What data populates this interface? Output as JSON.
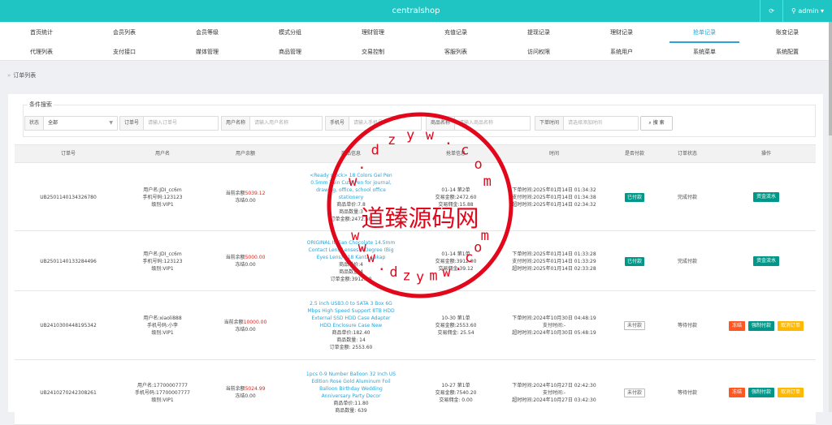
{
  "header": {
    "title": "centralshop",
    "refresh_icon": "refresh-icon",
    "user_icon": "user-icon",
    "user_label": "admin",
    "caret": "▾"
  },
  "nav": {
    "row1": [
      "首页统计",
      "会员列表",
      "会员等级",
      "模式分组",
      "理财管理",
      "充值记录",
      "提现记录",
      "理财记录",
      "抢单记录",
      "账变记录"
    ],
    "row2": [
      "代理列表",
      "支付接口",
      "媒体管理",
      "商品管理",
      "交易控制",
      "客服列表",
      "访问权限",
      "系统用户",
      "系统菜单",
      "系统配置"
    ],
    "active": "抢单记录"
  },
  "breadcrumb": {
    "separator": "»",
    "label": "订单列表"
  },
  "filter": {
    "legend": "条件搜索",
    "status_label": "状态",
    "status_value": "全部",
    "order_label": "订单号",
    "order_placeholder": "请输入订单号",
    "user_label": "用户名称",
    "user_placeholder": "请输入用户名称",
    "phone_label": "手机号",
    "phone_placeholder": "请输入手机号",
    "goods_label": "商品名称",
    "goods_placeholder": "请输入商品名称",
    "time_label": "下单时间",
    "time_placeholder": "请选择添加时间",
    "search_label": "搜 索",
    "search_icon": "search-icon"
  },
  "table": {
    "headers": [
      "订单号",
      "用户名",
      "用户余额",
      "商品信息",
      "抢单信息",
      "时间",
      "是否付款",
      "订单状态",
      "操作"
    ],
    "rows": [
      {
        "order_no": "UB2501140134326780",
        "user": [
          "用户名:JDI_cc6m",
          "手机号码:123123",
          "级别:VIP1"
        ],
        "balance_prefix": "当前余额",
        "balance": "5039.12",
        "frozen": "冻结0.00",
        "goods_title": "<Ready stock> 18 Colors Gel Pen 0.5mm Twin Cute Pen for journal, drawing, office, school office stationery",
        "goods_lines": [
          "商品单价:7.8",
          "商品数量:3",
          "订单金额:2472.60"
        ],
        "grab": [
          "01-14 第2单",
          "交易金额:2472.60",
          "交易佣金:15.88"
        ],
        "times": [
          "下单时间:2025年01月14日 01:34:32",
          "支付时间:2025年01月14日 01:34:38",
          "超时时间:2025年01月14日 02:34:32"
        ],
        "paid": "已付款",
        "paid_style": "green",
        "status": "完成付款",
        "ops": [
          {
            "label": "资金流水",
            "style": "green"
          }
        ]
      },
      {
        "order_no": "UB2501140133284496",
        "user": [
          "用户名:JDI_cc6m",
          "手机号码:123123",
          "级别:VIP1"
        ],
        "balance_prefix": "当前余额",
        "balance": "5000.00",
        "frozen": "冻结0.00",
        "goods_title": "ORIGINAL Italian Chocolate 14.5mm Contact Lens Lenses 0 Degree (Big Eyes Lens) 818 Kanta Lekap",
        "goods_lines": [
          "商品单价:4",
          "商品数量:4",
          "订单金额:3912.00"
        ],
        "grab": [
          "01-14 第1单",
          "交易金额:3912.00",
          "交易佣金:39.12"
        ],
        "times": [
          "下单时间:2025年01月14日 01:33:28",
          "支付时间:2025年01月14日 01:33:29",
          "超时时间:2025年01月14日 02:33:28"
        ],
        "paid": "已付款",
        "paid_style": "green",
        "status": "完成付款",
        "ops": [
          {
            "label": "资金流水",
            "style": "green"
          }
        ]
      },
      {
        "order_no": "UB2410300448195342",
        "user": [
          "用户名:xiaoli888",
          "手机号码:小李",
          "级别:VIP1"
        ],
        "balance_prefix": "当前余额",
        "balance": "10000.00",
        "frozen": "冻结0.00",
        "goods_title": "2.5 inch USB3.0 to SATA 3 Box 6G Mbps High Speed Support 8TB HDD External SSD HDD Case Adapter HDD Enclosure Case New",
        "goods_lines": [
          "商品单价:182.40",
          "商品数量: 14",
          "订单金额: 2553.60"
        ],
        "grab": [
          "10-30 第1单",
          "交易金额:2553.60",
          "交易佣金: 25.54"
        ],
        "times": [
          "下单时间:2024年10月30日 04:48:19",
          "支付时间:-",
          "超时时间:2024年10月30日 05:48:19"
        ],
        "paid": "未付款",
        "paid_style": "outline",
        "status": "等待付款",
        "ops": [
          {
            "label": "冻结",
            "style": "red"
          },
          {
            "label": "强制付款",
            "style": "green"
          },
          {
            "label": "取消订单",
            "style": "yellow"
          }
        ]
      },
      {
        "order_no": "UB2410270242308261",
        "user": [
          "用户名:17700007777",
          "手机号码:17700007777",
          "级别:VIP1"
        ],
        "balance_prefix": "当前余额",
        "balance": "5024.99",
        "frozen": "冻结0.00",
        "goods_title": "1pcs 0-9 Number Balloon 32 Inch US Edition Rose Gold Aluminum Foil Balloon Birthday Wedding Anniversary Party Decor",
        "goods_lines": [
          "商品单价:11.80",
          "商品数量: 639"
        ],
        "grab": [
          "10-27 第1单",
          "交易金额:7540.20",
          "交易佣金: 0.00"
        ],
        "times": [
          "下单时间:2024年10月27日 02:42:30",
          "支付时间:-",
          "超时时间:2024年10月27日 03:42:30"
        ],
        "paid": "未付款",
        "paid_style": "outline",
        "status": "等待付款",
        "ops": [
          {
            "label": "冻结",
            "style": "red"
          },
          {
            "label": "强制付款",
            "style": "green"
          },
          {
            "label": "取消订单",
            "style": "yellow"
          }
        ]
      }
    ]
  },
  "watermark": {
    "center_text": "道臻源码网",
    "ring_top": "w.dzyw.com",
    "ring_bottom": "www.dzymw.com"
  },
  "colors": {
    "accent": "#1ec5c2",
    "link": "#2aa4d8",
    "green": "#009688",
    "red": "#ff5722",
    "yellow": "#ffb800",
    "watermark": "#e3071c"
  }
}
